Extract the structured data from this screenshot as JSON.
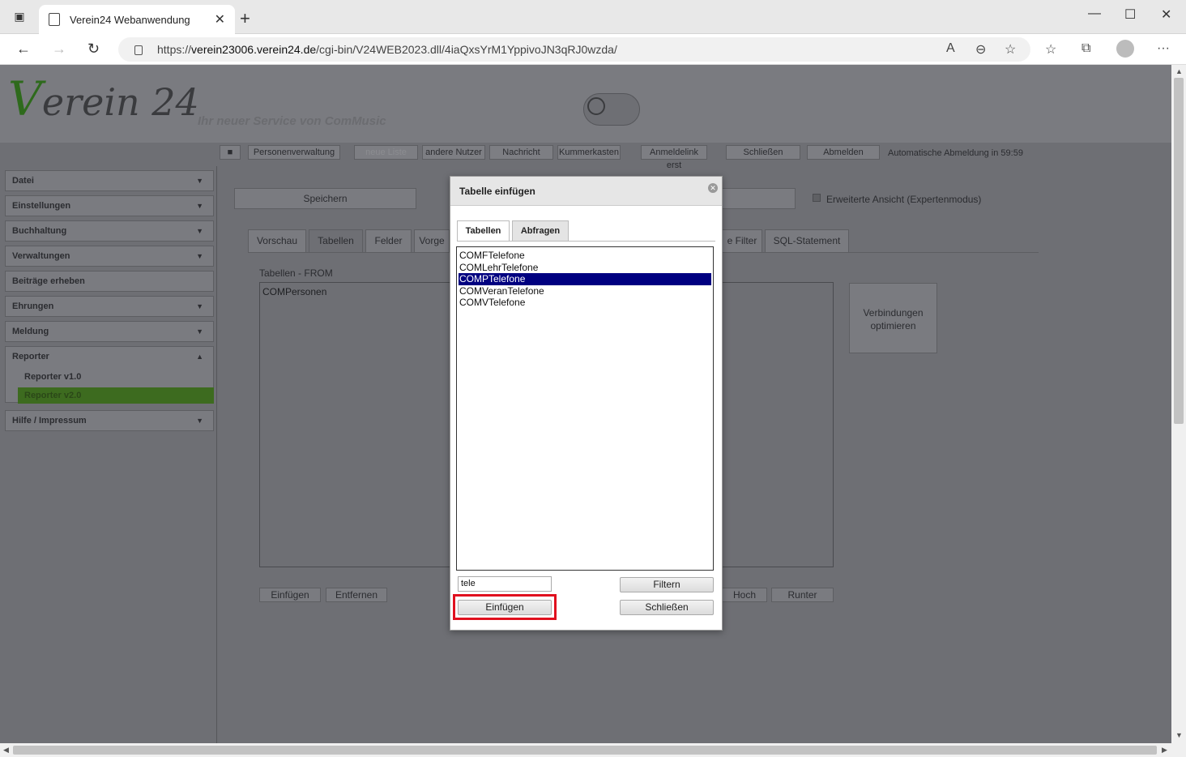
{
  "browser": {
    "tab_title": "Verein24 Webanwendung",
    "url_prefix": "https://",
    "url_domain": "verein23006.verein24.de",
    "url_path": "/cgi-bin/V24WEB2023.dll/4iaQxsYrM1YppivoJN3qRJ0wzda/"
  },
  "header": {
    "logo_v": "V",
    "logo_rest": "erein 24",
    "tagline": "Ihr neuer Service von ComMusic",
    "buttons": [
      "Personenverwaltung",
      "neue Liste",
      "andere Nutzer",
      "Nachricht",
      "Kummerkasten",
      "Anmeldelink erst",
      "Schließen",
      "Abmelden"
    ],
    "auto_logout": "Automatische Abmeldung in 59:59"
  },
  "sidebar": {
    "items": [
      "Datei",
      "Einstellungen",
      "Buchhaltung",
      "Verwaltungen",
      "Beiträge erheben",
      "Ehrungen",
      "Meldung",
      "Reporter",
      "Hilfe / Impressum"
    ],
    "reporter_sub": [
      "Reporter v1.0",
      "Reporter v2.0"
    ]
  },
  "main": {
    "save_label": "Speichern",
    "expert_mode_label": "Erweiterte Ansicht (Expertenmodus)",
    "tabs": [
      "Vorschau",
      "Tabellen",
      "Felder",
      "Vorge",
      "e Filter",
      "SQL-Statement"
    ],
    "from_label": "Tabellen - FROM",
    "from_items": [
      "COMPersonen"
    ],
    "optimize_label_1": "Verbindungen",
    "optimize_label_2": "optimieren",
    "bottom_buttons": [
      "Einfügen",
      "Entfernen",
      "Hoch",
      "Runter"
    ]
  },
  "dialog": {
    "title": "Tabelle einfügen",
    "tabs": [
      "Tabellen",
      "Abfragen"
    ],
    "list_items": [
      "COMFTelefone",
      "COMLehrTelefone",
      "COMPTelefone",
      "COMVeranTelefone",
      "COMVTelefone"
    ],
    "selected_item": "COMPTelefone",
    "filter_value": "tele",
    "filter_button": "Filtern",
    "insert_button": "Einfügen",
    "close_button": "Schließen"
  }
}
